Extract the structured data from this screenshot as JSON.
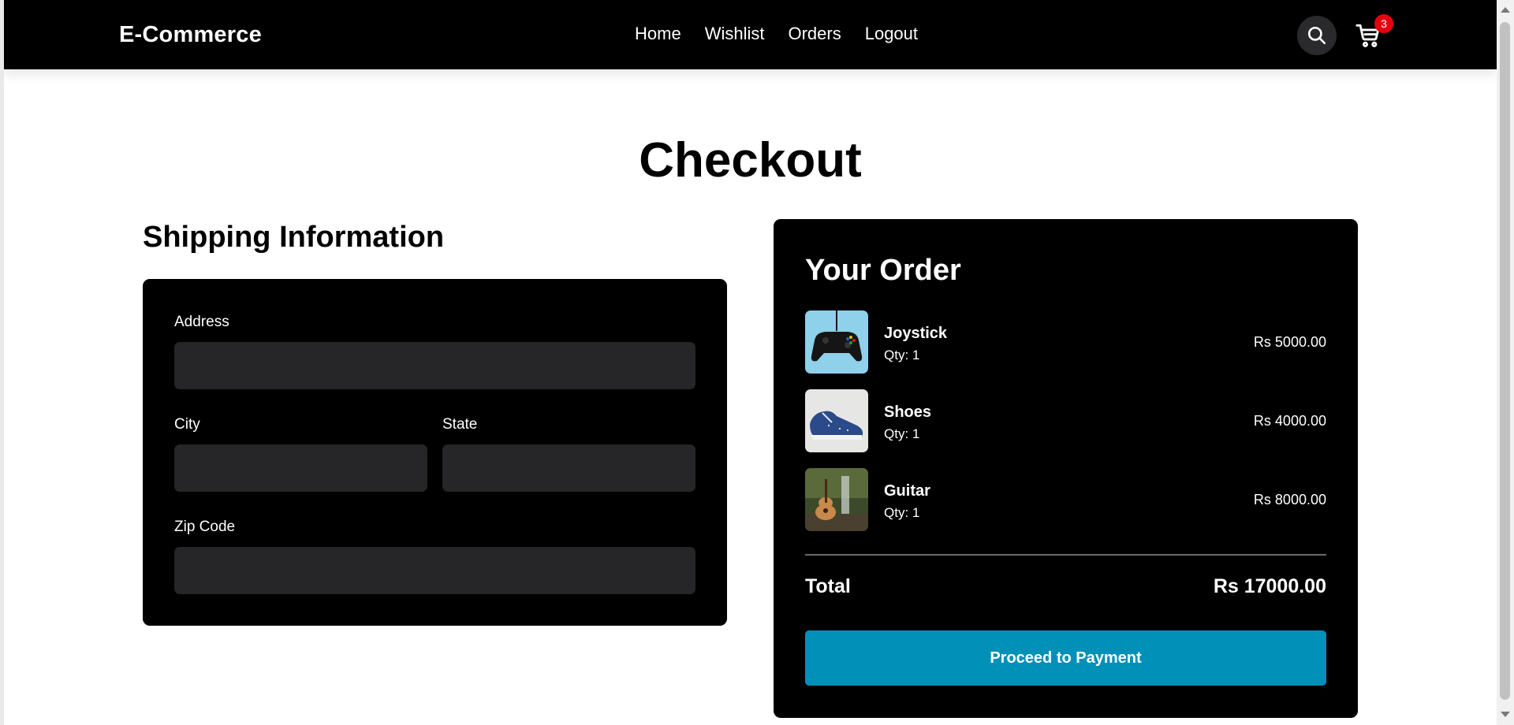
{
  "header": {
    "brand": "E-Commerce",
    "nav": [
      {
        "label": "Home"
      },
      {
        "label": "Wishlist"
      },
      {
        "label": "Orders"
      },
      {
        "label": "Logout"
      }
    ],
    "search_icon": "search-icon",
    "cart_icon": "cart-icon",
    "cart_count": "3",
    "badge_color": "#e5000f"
  },
  "page": {
    "title": "Checkout"
  },
  "shipping": {
    "title": "Shipping Information",
    "fields": {
      "address": {
        "label": "Address",
        "value": "",
        "placeholder": ""
      },
      "city": {
        "label": "City",
        "value": "",
        "placeholder": ""
      },
      "state": {
        "label": "State",
        "value": "",
        "placeholder": ""
      },
      "zip": {
        "label": "Zip Code",
        "value": "",
        "placeholder": ""
      }
    }
  },
  "order": {
    "title": "Your Order",
    "items": [
      {
        "name": "Joystick",
        "qty": "Qty: 1",
        "price": "Rs 5000.00",
        "thumb": "joystick-image"
      },
      {
        "name": "Shoes",
        "qty": "Qty: 1",
        "price": "Rs 4000.00",
        "thumb": "shoes-image"
      },
      {
        "name": "Guitar",
        "qty": "Qty: 1",
        "price": "Rs 8000.00",
        "thumb": "guitar-image"
      }
    ],
    "total_label": "Total",
    "total_value": "Rs 17000.00",
    "pay_button": "Proceed to Payment",
    "accent": "#0090b8"
  }
}
